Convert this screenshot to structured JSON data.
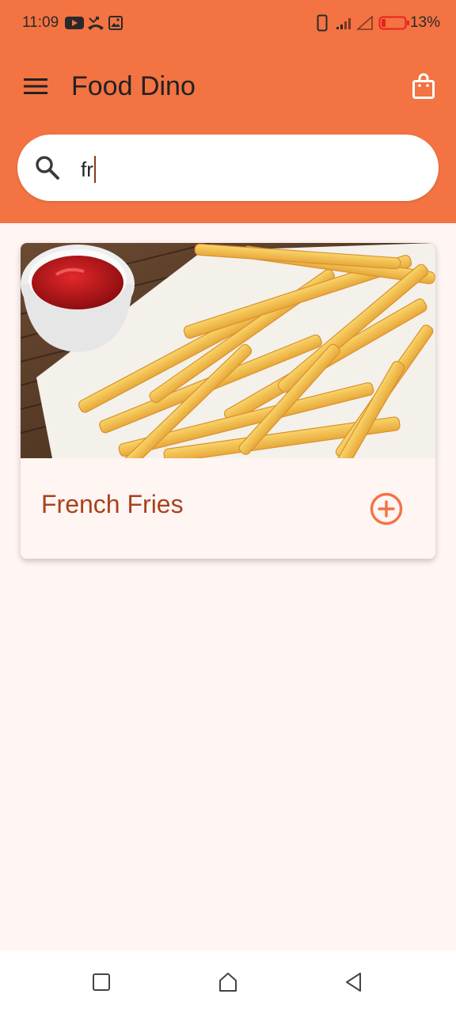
{
  "status_bar": {
    "time": "11:09",
    "battery_percent": "13%",
    "icons": [
      "youtube-icon",
      "missed-call-icon",
      "image-icon",
      "phone-outline-icon",
      "signal-icon",
      "no-signal-icon",
      "battery-low-icon"
    ]
  },
  "app": {
    "title": "Food Dino",
    "menu_icon": "menu-icon",
    "cart_icon": "shopping-bag-icon"
  },
  "search": {
    "value": "fr",
    "icon": "search-icon"
  },
  "results": [
    {
      "name": "French Fries",
      "image": "french-fries-photo",
      "action_icon": "add-circle-icon"
    }
  ],
  "nav_bar": {
    "buttons": [
      "recents-button",
      "home-button",
      "back-button"
    ]
  },
  "colors": {
    "header": "#f37342",
    "background": "#fff5f3",
    "accent": "#f37342",
    "title_text": "#a8431c"
  }
}
